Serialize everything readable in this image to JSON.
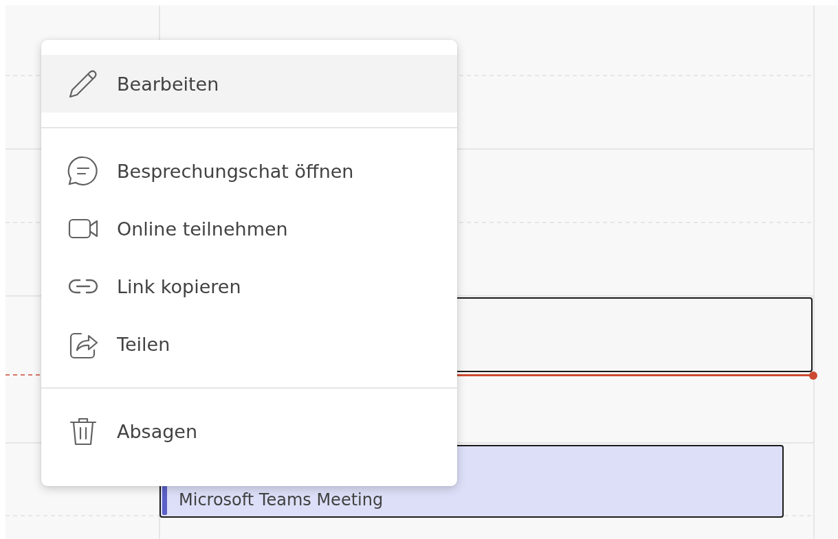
{
  "calendar": {
    "events": [
      {
        "kind": "plain",
        "color": "#f7f7f7"
      },
      {
        "kind": "accent",
        "color": "#dcdff7",
        "text": "Microsoft Teams Meeting"
      }
    ]
  },
  "context_menu": {
    "items": [
      {
        "kind": "item",
        "label": "Bearbeiten",
        "selected": true
      },
      {
        "kind": "divider"
      },
      {
        "kind": "item",
        "label": "Besprechungschat öffnen",
        "selected": false
      },
      {
        "kind": "item",
        "label": "Online teilnehmen",
        "selected": false
      },
      {
        "kind": "item",
        "label": "Link kopieren",
        "selected": false
      },
      {
        "kind": "item",
        "label": "Teilen",
        "selected": false
      },
      {
        "kind": "divider"
      },
      {
        "kind": "item",
        "label": "Absagen",
        "selected": false
      }
    ]
  }
}
